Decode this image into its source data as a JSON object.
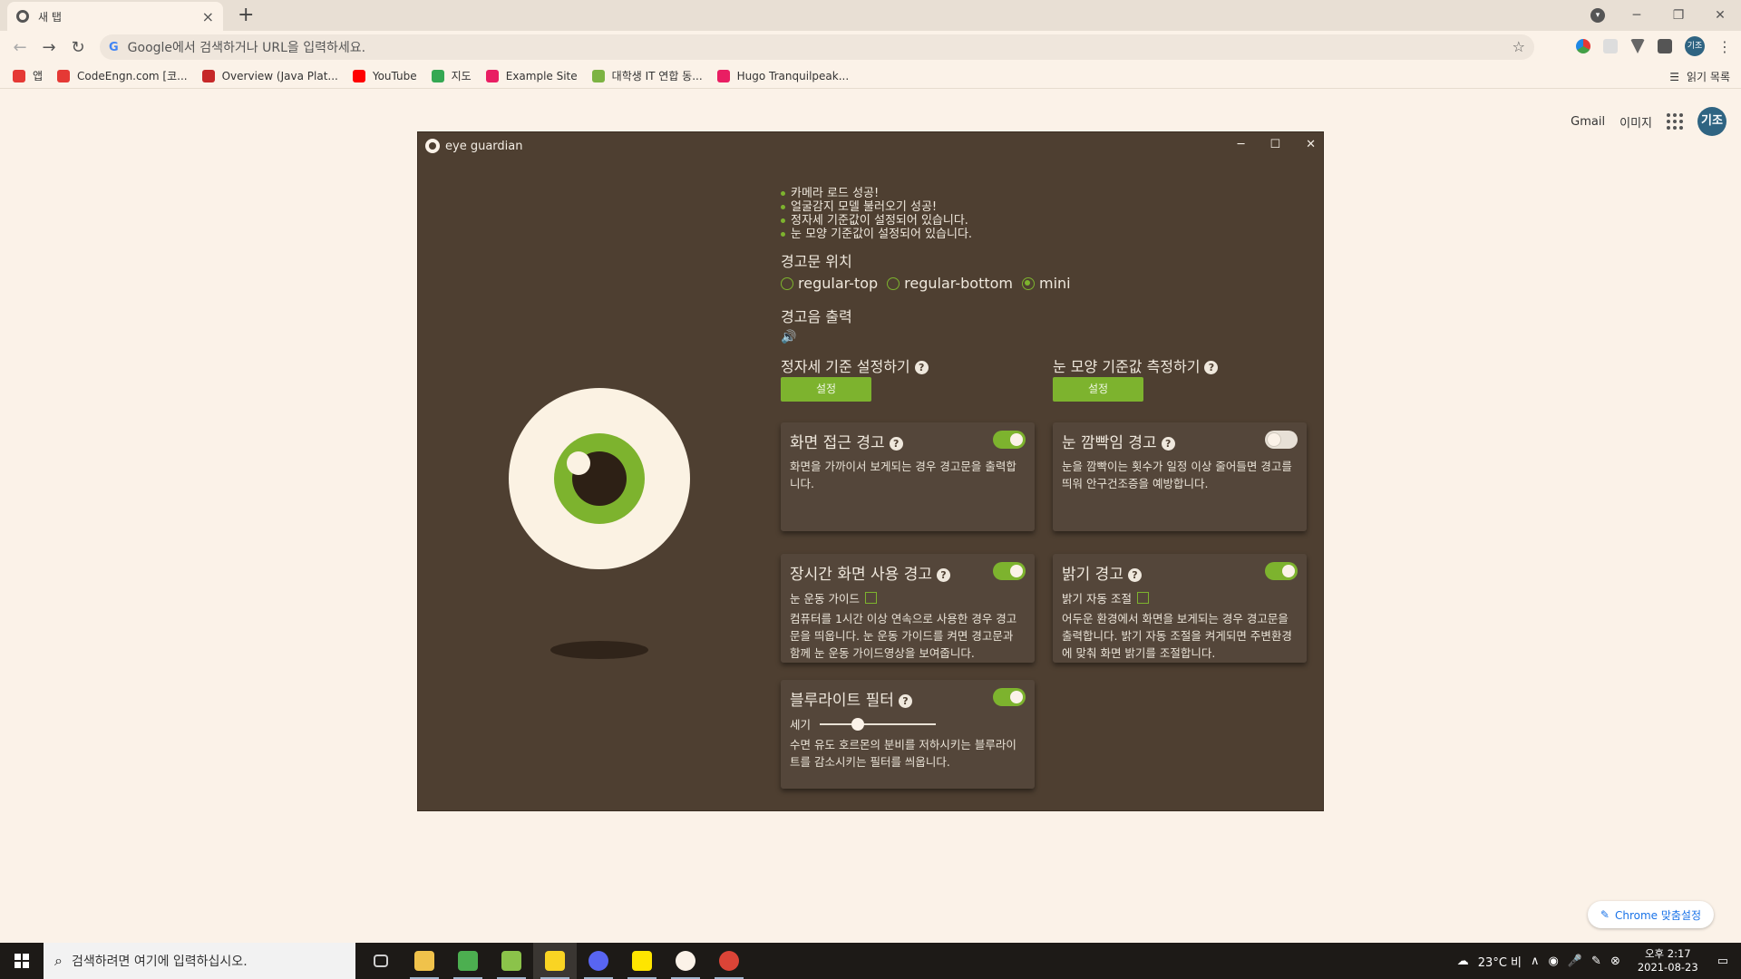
{
  "browser": {
    "tab_title": "새 탭",
    "tab_close": "×",
    "new_tab": "+",
    "omnibox_prefix": "G",
    "omnibox_placeholder": "Google에서 검색하거나 URL을 입력하세요.",
    "window_controls": {
      "minimize": "─",
      "restore": "❐",
      "close": "✕"
    },
    "profile_initial": "기조",
    "bookmarks": [
      {
        "label": "앱",
        "color": "#e53935"
      },
      {
        "label": "CodeEngn.com [코...",
        "color": "#e53935"
      },
      {
        "label": "Overview (Java Plat...",
        "color": "#c62828"
      },
      {
        "label": "YouTube",
        "color": "#ff0000"
      },
      {
        "label": "지도",
        "color": "#34a853"
      },
      {
        "label": "Example Site",
        "color": "#e91e63"
      },
      {
        "label": "대학생 IT 연합 동...",
        "color": "#7cb342"
      },
      {
        "label": "Hugo Tranquilpeak...",
        "color": "#e91e63"
      }
    ],
    "reading_list": "읽기 목록"
  },
  "ntp": {
    "gmail": "Gmail",
    "images": "이미지",
    "avatar": "기조",
    "customize": "Chrome 맞춤설정"
  },
  "app": {
    "title": "eye guardian",
    "controls": {
      "minimize": "─",
      "maximize": "☐",
      "close": "✕"
    },
    "status_lines": [
      "카메라 로드 성공!",
      "얼굴감지 모델 불러오기 성공!",
      "정자세 기준값이 설정되어 있습니다.",
      "눈 모양 기준값이 설정되어 있습니다."
    ],
    "warning_position_label": "경고문 위치",
    "radio_options": [
      "regular-top",
      "regular-bottom",
      "mini"
    ],
    "selected_radio": "mini",
    "sound_label": "경고음 출력",
    "speaker_icon": "🔊",
    "posture_label": "정자세 기준 설정하기",
    "eye_shape_label": "눈 모양 기준값 측정하기",
    "set_button": "설정",
    "help_glyph": "?",
    "accent_color": "#7db32e",
    "background_color": "#4e3f31",
    "cards": {
      "proximity": {
        "title": "화면 접근 경고",
        "enabled": true,
        "desc": "화면을 가까이서 보게되는 경우 경고문을 출력합니다."
      },
      "blink": {
        "title": "눈 깜빡임 경고",
        "enabled": false,
        "desc": "눈을 깜빡이는 횟수가 일정 이상 줄어들면 경고를 띄워 안구건조증을 예방합니다."
      },
      "longuse": {
        "title": "장시간 화면 사용 경고",
        "enabled": true,
        "option": "눈 운동 가이드",
        "desc": "컴퓨터를 1시간 이상 연속으로 사용한 경우 경고문을 띄웁니다. 눈 운동 가이드를 켜면 경고문과 함께 눈 운동 가이드영상을 보여줍니다."
      },
      "brightness": {
        "title": "밝기 경고",
        "enabled": true,
        "option": "밝기 자동 조절",
        "desc": "어두운 환경에서 화면을 보게되는 경우 경고문을 출력합니다. 밝기 자동 조절을 켜게되면 주변환경에 맞춰 화면 밝기를 조절합니다."
      },
      "bluelight": {
        "title": "블루라이트 필터",
        "enabled": true,
        "slider_label": "세기",
        "slider_value": 0.33,
        "desc": "수면 유도 호르몬의 분비를 저하시키는 블루라이트를 감소시키는 필터를 씌웁니다."
      }
    }
  },
  "taskbar": {
    "search_placeholder": "검색하려면 여기에 입력하십시오.",
    "weather": "23°C 비",
    "time": "오후 2:17",
    "date": "2021-08-23",
    "apps": [
      {
        "name": "task-view",
        "color": "#cfcfcf"
      },
      {
        "name": "file-explorer",
        "color": "#f0c24b"
      },
      {
        "name": "wing-app",
        "color": "#4caf50"
      },
      {
        "name": "lambda-app",
        "color": "#8bc34a"
      },
      {
        "name": "sticky-notes",
        "color": "#f9d423"
      },
      {
        "name": "discord",
        "color": "#5865f2"
      },
      {
        "name": "kakaotalk",
        "color": "#fee500"
      },
      {
        "name": "eye-guardian",
        "color": "#fbf2e8"
      },
      {
        "name": "chrome",
        "color": "#db4437"
      }
    ]
  }
}
